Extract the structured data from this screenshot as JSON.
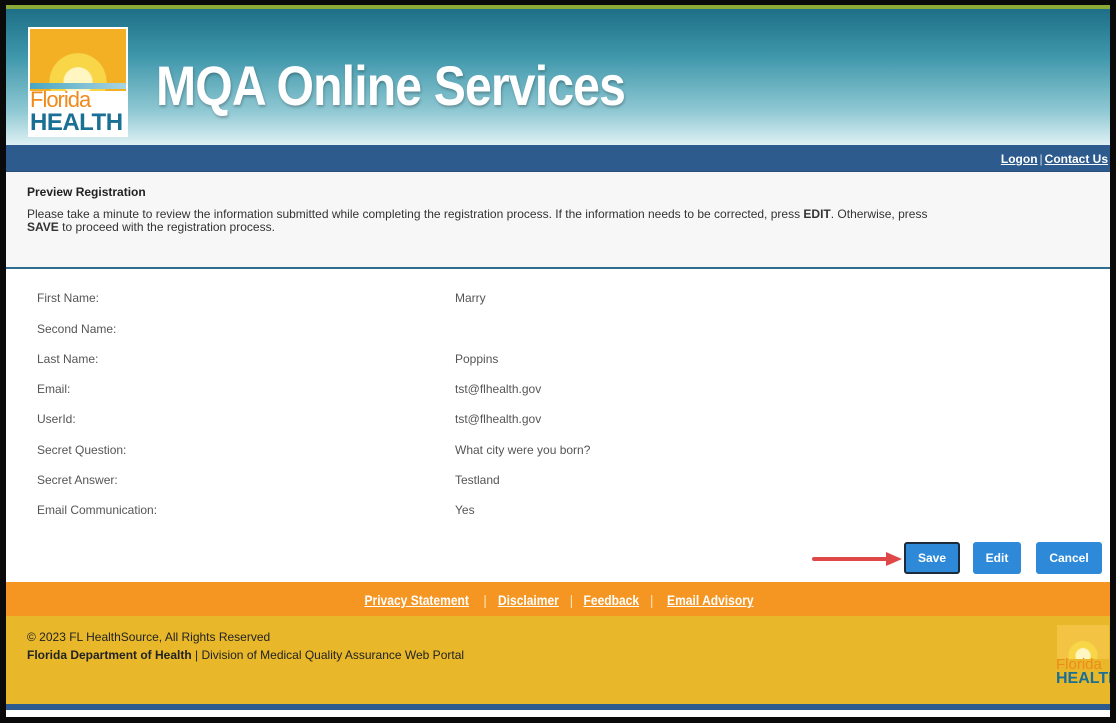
{
  "header": {
    "logo": {
      "florida": "Florida",
      "health": "HEALTH"
    },
    "title": "MQA Online Services"
  },
  "nav": {
    "logon": "Logon",
    "separator": "|",
    "contact": "Contact Us"
  },
  "preview": {
    "title": "Preview Registration",
    "text_part1": "Please take a minute to review the information submitted while completing the registration process. If the information needs to be corrected, press ",
    "edit_word": "EDIT",
    "text_part2": ". Otherwise, press ",
    "save_word": "SAVE",
    "text_part3": " to proceed with the registration process."
  },
  "fields": [
    {
      "label": "First Name:",
      "value": "Marry"
    },
    {
      "label": "Second Name:",
      "value": ""
    },
    {
      "label": "Last Name:",
      "value": "Poppins"
    },
    {
      "label": "Email:",
      "value": "tst@flhealth.gov"
    },
    {
      "label": "UserId:",
      "value": "tst@flhealth.gov"
    },
    {
      "label": "Secret Question:",
      "value": "What city were you born?"
    },
    {
      "label": "Secret Answer:",
      "value": "Testland"
    },
    {
      "label": "Email Communication:",
      "value": "Yes"
    }
  ],
  "buttons": {
    "save": "Save",
    "edit": "Edit",
    "cancel": "Cancel"
  },
  "footer": {
    "links": [
      "Privacy Statement",
      "Disclaimer",
      "Feedback",
      "Email Advisory"
    ],
    "separator": "|",
    "copyright": "© 2023 FL HealthSource, All Rights Reserved",
    "dept_bold": "Florida Department of Health",
    "dept_rest": " | Division of Medical Quality Assurance Web Portal",
    "logo": {
      "florida": "Florida",
      "health": "HEALTH"
    }
  },
  "colors": {
    "header_teal": "#1d6f86",
    "nav_blue": "#2e5b8e",
    "button_blue": "#2e8ad8",
    "footer_orange": "#f59622",
    "footer_gold": "#e8b82a",
    "arrow_red": "#e04848"
  }
}
